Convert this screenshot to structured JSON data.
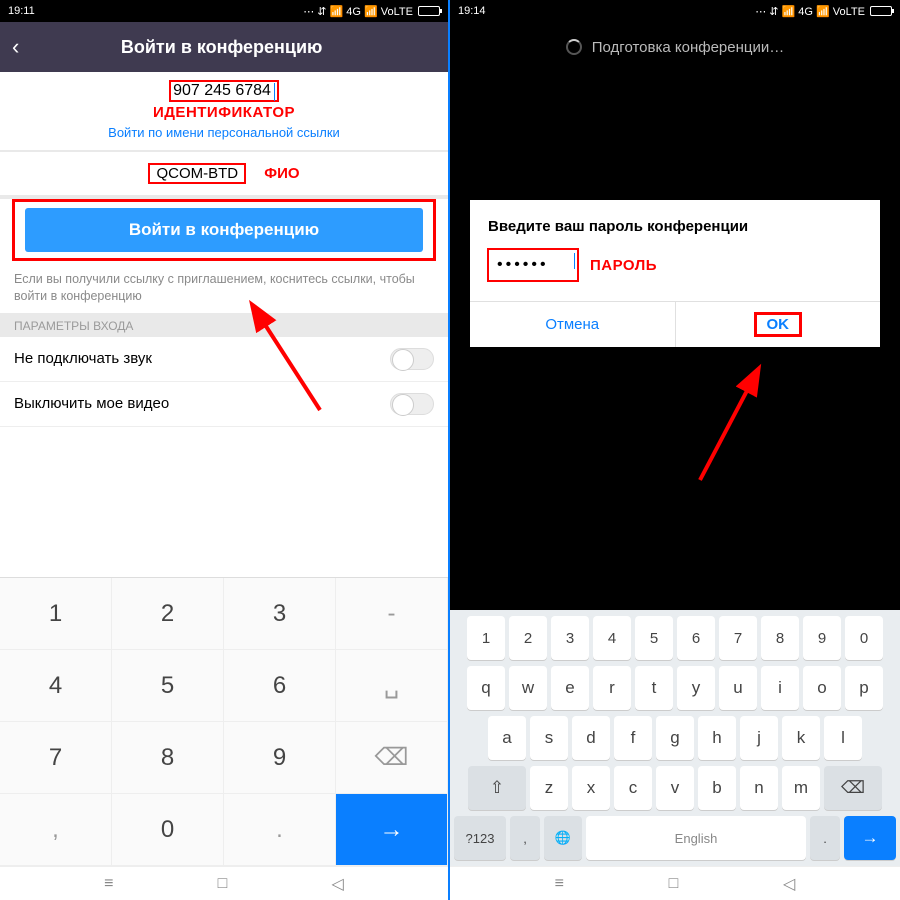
{
  "left": {
    "time": "19:11",
    "status_icons": "⋯  ⇵  📶 4G 📶  VoLTE",
    "header_title": "Войти в конференцию",
    "meeting_id": "907 245 6784",
    "anno_identifier": "ИДЕНТИФИКАТОР",
    "personal_link": "Войти по имени персональной ссылки",
    "name_value": "QCOM-BTD",
    "anno_fio": "ФИО",
    "join_button": "Войти в конференцию",
    "hint": "Если вы получили ссылку с приглашением, коснитесь ссылки, чтобы войти в конференцию",
    "section_title": "ПАРАМЕТРЫ ВХОДА",
    "toggle_audio": "Не подключать звук",
    "toggle_video": "Выключить мое видео",
    "numpad": {
      "r1": [
        "1",
        "2",
        "3",
        "-"
      ],
      "r2": [
        "4",
        "5",
        "6",
        "␣"
      ],
      "r3": [
        "7",
        "8",
        "9"
      ],
      "bksp": "⌫",
      "r4": [
        ",",
        "0",
        "."
      ],
      "go": "→"
    }
  },
  "right": {
    "time": "19:14",
    "status_icons": "⋯  ⇵  📶 4G 📶  VoLTE",
    "loading": "Подготовка конференции…",
    "dialog_title": "Введите ваш пароль конференции",
    "password_dots": "••••••",
    "anno_password": "ПАРОЛЬ",
    "btn_cancel": "Отмена",
    "btn_ok": "OK",
    "kbd": {
      "nums": [
        "1",
        "2",
        "3",
        "4",
        "5",
        "6",
        "7",
        "8",
        "9",
        "0"
      ],
      "row1": [
        "q",
        "w",
        "e",
        "r",
        "t",
        "y",
        "u",
        "i",
        "o",
        "p"
      ],
      "row2": [
        "a",
        "s",
        "d",
        "f",
        "g",
        "h",
        "j",
        "k",
        "l"
      ],
      "row3_shift": "⇧",
      "row3": [
        "z",
        "x",
        "c",
        "v",
        "b",
        "n",
        "m"
      ],
      "row3_bksp": "⌫",
      "row4_sym": "?123",
      "row4_comma": ",",
      "row4_globe": "🌐",
      "row4_space": "English",
      "row4_dot": ".",
      "row4_enter": "→"
    }
  },
  "nav": {
    "menu": "≡",
    "home": "□",
    "back": "◁"
  }
}
